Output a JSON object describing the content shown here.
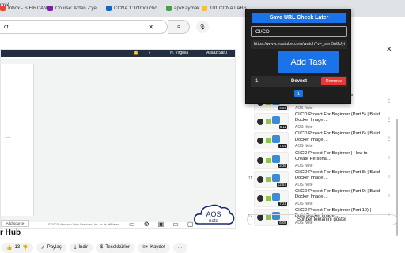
{
  "tabs": [
    {
      "label": "my4",
      "active": false
    },
    {
      "label": "Inbox - SIFIRDAN...",
      "active": false
    },
    {
      "label": "Course: A'dan Z'ye...",
      "active": false
    },
    {
      "label": "CCNA 1: Introductio...",
      "active": false
    },
    {
      "label": "apkKaymak",
      "active": false
    },
    {
      "label": "101 CCNA LABS",
      "active": false
    }
  ],
  "youtube": {
    "search_value": "ct",
    "clear_symbol": "✕",
    "search_icon_glyph": "⌕",
    "mic_icon_glyph": "🎙"
  },
  "video": {
    "aws_bar": {
      "region": "N. Virginia",
      "user": "Asaaz Saru"
    },
    "console_text": "...and...",
    "console_button": "Add source",
    "copyright": "© 2023, Amazon Web Services, Inc. or its affiliates.",
    "watermark": "AOS note",
    "title": "r Hub"
  },
  "actions": [
    {
      "name": "like",
      "icon": "👍",
      "label": "13"
    },
    {
      "name": "dislike",
      "icon": "👎",
      "label": ""
    },
    {
      "name": "share",
      "icon": "↗",
      "label": "Paylaş"
    },
    {
      "name": "download",
      "icon": "⤓",
      "label": "İndir"
    },
    {
      "name": "thanks",
      "icon": "$",
      "label": "Teşekkürler"
    },
    {
      "name": "save",
      "icon": "≡+",
      "label": "Kaydet"
    },
    {
      "name": "more",
      "icon": "⋯",
      "label": ""
    }
  ],
  "playlist": [
    {
      "num": "",
      "title": "(Part 4) | Build Docker Image ...",
      "channel": "AOS Note",
      "duration": "6:26"
    },
    {
      "num": "",
      "title": "CI/CD Project For Beginner (Part 5) | Build Docker Image ...",
      "channel": "AOS Note",
      "duration": "8:11"
    },
    {
      "num": "",
      "title": "CI/CD Project For Beginner (Part 6) | Build Docker Image ...",
      "channel": "AOS Note",
      "duration": "7:01"
    },
    {
      "num": "",
      "title": "CI/CD Project For Beginner | How to Create Personal...",
      "channel": "AOS Note",
      "duration": "2:36"
    },
    {
      "num": "11",
      "title": "CI/CD Project For Beginner (Part 8) | Build Docker Image ...",
      "channel": "AOS Note",
      "duration": "12:57"
    },
    {
      "num": "",
      "title": "CI/CD Project For Beginner (Part 9) | Build Docker Image ...",
      "channel": "AOS Note",
      "duration": "7:21"
    },
    {
      "num": "12",
      "title": "CI/CD Project For Beginner (Part 10) | Build Docker Image ...",
      "channel": "AOS Note",
      "duration": "6:08"
    }
  ],
  "chat_button": "Sohbet tekranını göster",
  "popup": {
    "save_button": "Save URL Check Later",
    "task_input_value": "CI/CD",
    "url_value": "https://www.youtube.com/watch?v=_sen5n8Uyi",
    "add_button": "Add Task",
    "tasks": [
      {
        "num": "1.",
        "title": "Devnet",
        "remove_label": "Remove"
      }
    ],
    "page": "1"
  },
  "colors": {
    "popup_bg": "#1e1e1e",
    "accent_blue": "#1a73e8",
    "remove_red": "#e53935",
    "aws_dark": "#232f3e"
  }
}
